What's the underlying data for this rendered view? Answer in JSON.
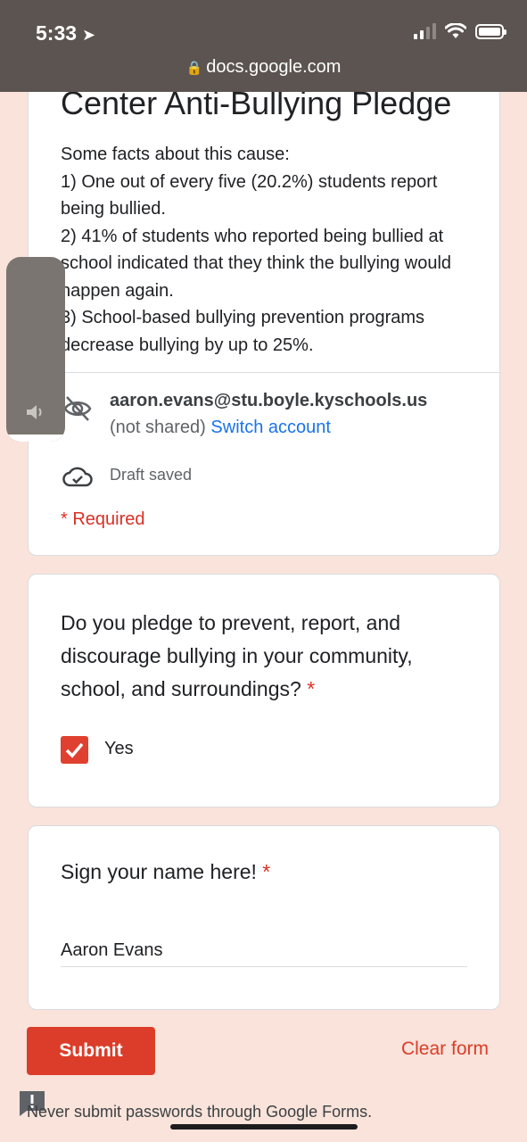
{
  "status_bar": {
    "time": "5:33",
    "location_icon": "location-arrow-icon",
    "signal_icon": "cellular-signal-icon",
    "wifi_icon": "wifi-icon",
    "battery_icon": "battery-icon"
  },
  "url_bar": {
    "lock_icon": "lock-icon",
    "url": "docs.google.com"
  },
  "form_header": {
    "title": "Center Anti-Bullying Pledge",
    "facts": [
      "Some facts about this cause:",
      "1) One out of every five (20.2%) students report being bullied.",
      "2) 41% of students who reported being bullied at school indicated that they think the bullying would happen again.",
      "3) School-based bullying prevention programs decrease bullying by up to 25%."
    ],
    "account_email": "aaron.evans@stu.boyle.kyschools.us",
    "not_shared": "(not shared)",
    "switch_account": "Switch account",
    "draft_status": "Draft saved",
    "required_note": "* Required"
  },
  "question_pledge": {
    "text": "Do you pledge to prevent, report, and discourage bullying in your community, school, and surroundings?",
    "required_star": "*",
    "option_label": "Yes",
    "checked": true
  },
  "question_signature": {
    "text": "Sign your name here!",
    "required_star": "*",
    "value": "Aaron Evans"
  },
  "actions": {
    "submit_label": "Submit",
    "clear_label": "Clear form"
  },
  "footer": {
    "warning": "Never submit passwords through Google Forms."
  },
  "volume_overlay": {
    "level_fraction": 0.04,
    "icon": "speaker-icon"
  },
  "colors": {
    "background": "#f9e3da",
    "accent": "#db3d2a",
    "link": "#1a73e8",
    "required": "#d93025"
  }
}
